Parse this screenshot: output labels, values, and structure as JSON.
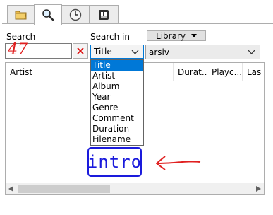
{
  "tabs": [
    {
      "icon": "folder-icon"
    },
    {
      "icon": "search-icon"
    },
    {
      "icon": "clock-icon"
    },
    {
      "icon": "playlist-icon"
    }
  ],
  "search": {
    "label": "Search",
    "value": "47",
    "clear_icon": "clear-icon"
  },
  "search_in": {
    "label": "Search in",
    "selected": "Title",
    "options": [
      "Title",
      "Artist",
      "Album",
      "Year",
      "Genre",
      "Comment",
      "Duration",
      "Filename"
    ]
  },
  "library": {
    "button_label": "Library",
    "selected": "arsiv"
  },
  "table": {
    "columns": [
      "Artist",
      "Durat...",
      "Playc...",
      "Las"
    ]
  },
  "annotation": {
    "text": "intro",
    "color": "#1a1adc",
    "arrow_color": "#e02020"
  },
  "colors": {
    "accent": "#0078d7",
    "search_value": "#e02020"
  }
}
